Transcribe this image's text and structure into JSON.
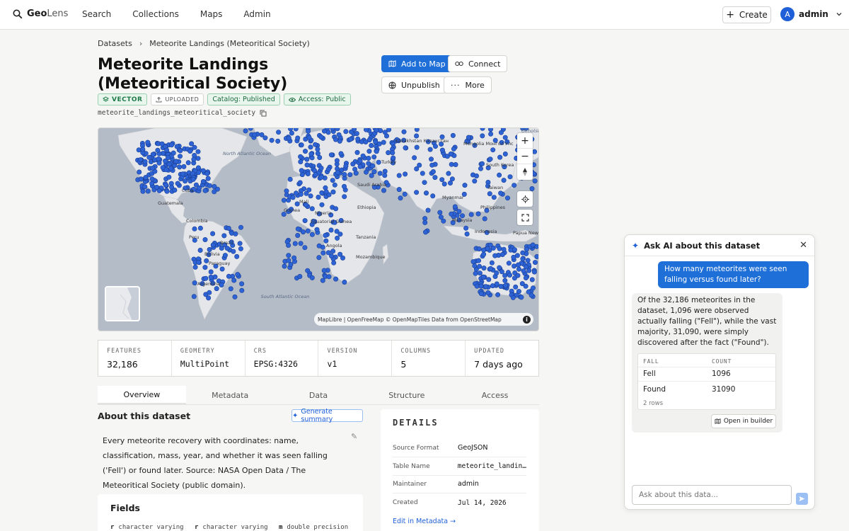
{
  "app": {
    "logo_main": "Geo",
    "logo_accent": "Lens"
  },
  "nav": {
    "items": [
      "Search",
      "Collections",
      "Maps",
      "Admin"
    ],
    "create_label": "Create",
    "user_initial": "A",
    "user_name": "admin"
  },
  "breadcrumb": {
    "root": "Datasets",
    "current": "Meteorite Landings (Meteoritical Society)"
  },
  "dataset": {
    "title": "Meteorite Landings (Meteoritical Society)",
    "badges": {
      "type": "VECTOR",
      "source": "UPLOADED",
      "catalog": "Catalog: Published",
      "access": "Access: Public"
    },
    "table_name": "meteorite_landings_meteoritical_society"
  },
  "actions": {
    "add_to_map": "Add to Map",
    "connect": "Connect",
    "unpublish": "Unpublish",
    "more": "More"
  },
  "map": {
    "labels": [
      "North Atlantic Ocean",
      "South Atlantic Ocean",
      "Cuba",
      "Guatemala",
      "Colombia",
      "Peru",
      "Brazil",
      "Bolivia",
      "Paraguay",
      "Argentina",
      "Guinea",
      "Mali",
      "Nigeria",
      "Equatorial Guinea",
      "Angola",
      "Mozambique",
      "Tanzania",
      "Ethiopia",
      "Saudi Arabia",
      "Kazakhstan Казахстан",
      "Mongolia Монгол Улс",
      "Turkey",
      "South Korea",
      "Taiwan",
      "Philippines",
      "Malaysia",
      "Indonesia",
      "Papua New Guinea",
      "Myanmar",
      "Okhotsk"
    ],
    "attribution": "MapLibre | OpenFreeMap © OpenMapTiles Data from OpenStreetMap",
    "zoom_in": "+",
    "zoom_out": "−"
  },
  "stats": [
    {
      "label": "FEATURES",
      "value": "32,186"
    },
    {
      "label": "GEOMETRY",
      "value": "MultiPoint"
    },
    {
      "label": "CRS",
      "value": "EPSG:4326"
    },
    {
      "label": "VERSION",
      "value": "v1"
    },
    {
      "label": "COLUMNS",
      "value": "5"
    },
    {
      "label": "UPDATED",
      "value": "7 days ago"
    }
  ],
  "tabs": [
    "Overview",
    "Metadata",
    "Data",
    "Structure",
    "Access"
  ],
  "about": {
    "heading": "About this dataset",
    "generate_label": "Generate summary",
    "text": "Every meteorite recovery with coordinates: name, classification, mass, year, and whether it was seen falling ('Fell') or found later. Source: NASA Open Data / The Meteoritical Society (public domain)."
  },
  "fields": {
    "heading": "Fields",
    "types": [
      "character varying",
      "character varying",
      "double precision"
    ]
  },
  "details": {
    "heading": "DETAILS",
    "rows": [
      {
        "key": "Source Format",
        "value": "GeoJSON"
      },
      {
        "key": "Table Name",
        "value": "meteorite_landin…"
      },
      {
        "key": "Maintainer",
        "value": "admin"
      },
      {
        "key": "Created",
        "value": "Jul 14, 2026"
      }
    ],
    "edit_link": "Edit in Metadata →"
  },
  "chat": {
    "title": "Ask AI about this dataset",
    "user_message": "How many meteorites were seen falling versus found later?",
    "ai_message": "Of the 32,186 meteorites in the dataset, 1,096 were observed actually falling (\"Fell\"), while the vast majority, 31,090, were simply discovered after the fact (\"Found\").",
    "table": {
      "headers": [
        "FALL",
        "COUNT"
      ],
      "rows": [
        [
          "Fell",
          "1096"
        ],
        [
          "Found",
          "31090"
        ]
      ],
      "row_count": "2 rows"
    },
    "open_builder": "Open in builder",
    "input_placeholder": "Ask about this data..."
  },
  "colors": {
    "accent": "#1f6fd8",
    "points": "#2d63d4",
    "ocean": "#b4bcc8",
    "land": "#e4e6e9"
  }
}
